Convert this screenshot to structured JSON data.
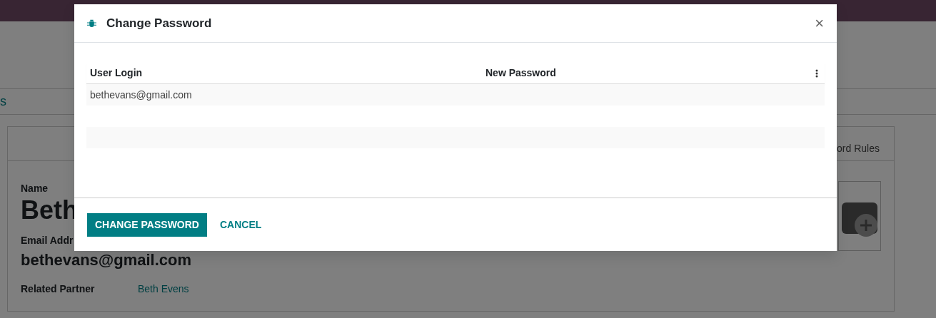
{
  "breadcrumb": "s",
  "form": {
    "tab": "ord Rules",
    "fields": [
      {
        "label": "Name",
        "value": "Beth",
        "kind": "title"
      },
      {
        "label": "Email Addr",
        "value": "bethevans@gmail.com",
        "kind": "subtitle"
      },
      {
        "label": "Related Partner",
        "value": "Beth Evens",
        "kind": "link"
      }
    ]
  },
  "dialog": {
    "title": "Change Password",
    "close": "×",
    "columns": [
      "User Login",
      "New Password"
    ],
    "rows": [
      {
        "user_login": "bethevans@gmail.com"
      }
    ],
    "buttons": [
      {
        "label": "CHANGE PASSWORD",
        "kind": "primary"
      },
      {
        "label": "CANCEL",
        "kind": "link"
      }
    ]
  }
}
